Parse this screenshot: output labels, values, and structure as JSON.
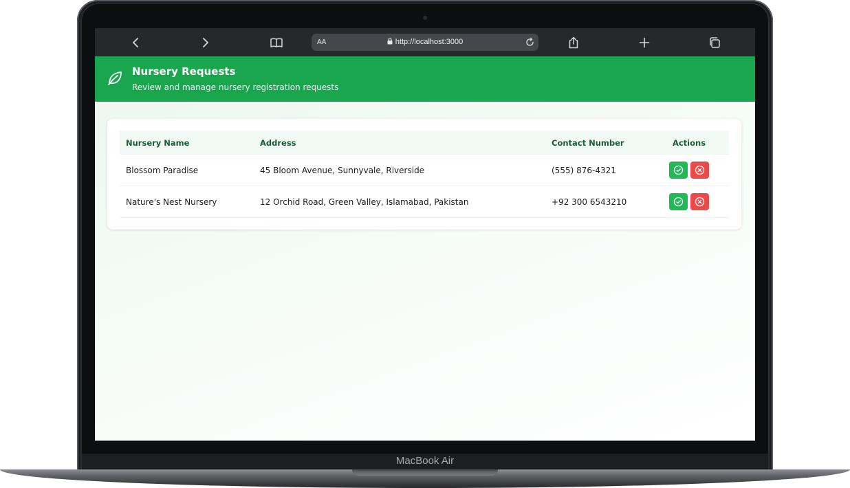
{
  "device": {
    "label": "MacBook Air"
  },
  "browser": {
    "url": "http://localhost:3000",
    "text_size_label": "AA",
    "icons": [
      "back-icon",
      "forward-icon",
      "reader-icon",
      "lock-icon",
      "reload-icon",
      "share-icon",
      "new-tab-icon",
      "tabs-icon"
    ]
  },
  "header": {
    "title": "Nursery Requests",
    "subtitle": "Review and manage nursery registration requests",
    "icon": "leaf-icon",
    "bg_color": "#19a64e"
  },
  "table": {
    "columns": [
      "Nursery Name",
      "Address",
      "Contact Number",
      "Actions"
    ],
    "rows": [
      {
        "name": "Blossom Paradise",
        "address": "45 Bloom Avenue, Sunnyvale, Riverside",
        "contact": "(555) 876-4321"
      },
      {
        "name": "Nature's Nest Nursery",
        "address": "12 Orchid Road, Green Valley, Islamabad, Pakistan",
        "contact": "+92 300 6543210"
      }
    ],
    "approve_color": "#22b857",
    "reject_color": "#ec4a4a"
  }
}
